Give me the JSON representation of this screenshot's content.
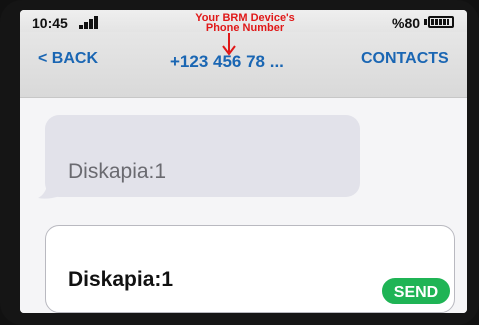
{
  "status_bar": {
    "time": "10:45",
    "battery_percent": "%80"
  },
  "annotation": {
    "line1": "Your BRM Device's",
    "line2": "Phone Number"
  },
  "nav": {
    "back_label": "< BACK",
    "phone_number": "+123 456 78 ...",
    "contacts_label": "CONTACTS"
  },
  "messages": [
    {
      "text": "Diskapia:1"
    }
  ],
  "composer": {
    "value": "Diskapia:1",
    "send_label": "SEND"
  },
  "colors": {
    "link_blue": "#1a66b3",
    "annotation_red": "#e01818",
    "send_green": "#1fb455",
    "incoming_bubble": "#e2e2ea"
  }
}
